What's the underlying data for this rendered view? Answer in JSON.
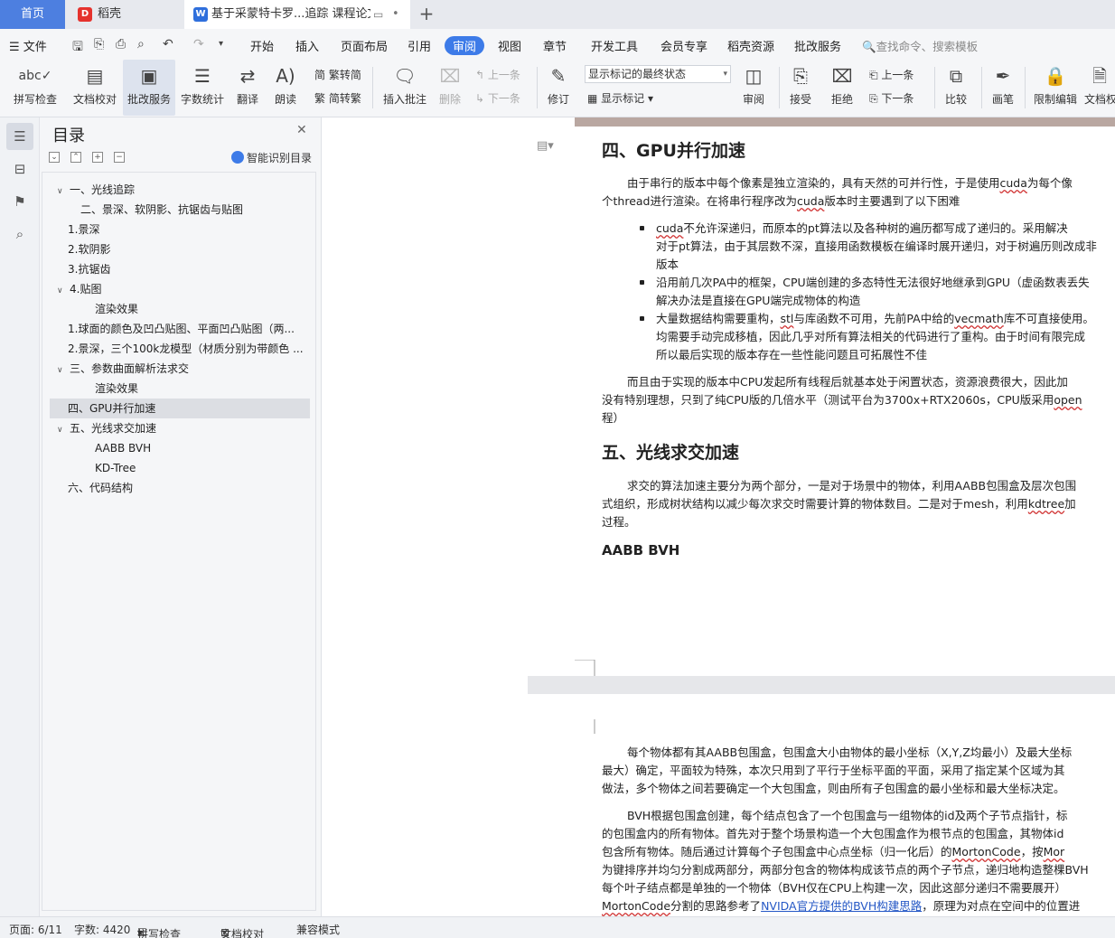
{
  "tabs": {
    "home": "首页",
    "daoke": "稻壳",
    "doc": "基于采蒙特卡罗...追踪 课程论文",
    "add_icon": "plus-icon"
  },
  "menu": {
    "file": "文件",
    "items": [
      "开始",
      "插入",
      "页面布局",
      "引用",
      "审阅",
      "视图",
      "章节",
      "开发工具",
      "会员专享",
      "稻壳资源",
      "批改服务"
    ],
    "active": "审阅",
    "search": "查找命令、搜索模板"
  },
  "ribbon": {
    "spell": "拼写检查",
    "proof": "文档校对",
    "correct_service": "批改服务",
    "wordcount": "字数统计",
    "translate": "翻译",
    "read": "朗读",
    "trad": "繁转简",
    "simp": "简转繁",
    "insert_comment": "插入批注",
    "delete": "删除",
    "prev": "上一条",
    "next": "下一条",
    "revise": "修订",
    "mark_select": "显示标记的最终状态",
    "show_marks": "显示标记",
    "review": "审阅",
    "accept": "接受",
    "reject": "拒绝",
    "prev2": "上一条",
    "next2": "下一条",
    "compare": "比较",
    "pen": "画笔",
    "restrict": "限制编辑",
    "docright": "文档权"
  },
  "outline": {
    "title": "目录",
    "smart": "智能识别目录",
    "items": [
      {
        "text": "一、光线追踪",
        "caret": "v"
      },
      {
        "text": "二、景深、软阴影、抗锯齿与贴图",
        "caret": ""
      },
      {
        "text": "1.景深",
        "caret": ""
      },
      {
        "text": "2.软阴影",
        "caret": ""
      },
      {
        "text": "3.抗锯齿",
        "caret": ""
      },
      {
        "text": "4.贴图",
        "caret": "v"
      },
      {
        "text": "渲染效果",
        "caret": ""
      },
      {
        "text": "1.球面的颜色及凹凸贴图、平面凹凸贴图（两...",
        "caret": ""
      },
      {
        "text": "2.景深，三个100k龙模型（材质分别为带颜色 ...",
        "caret": ""
      },
      {
        "text": "三、参数曲面解析法求交",
        "caret": "v"
      },
      {
        "text": "渲染效果",
        "caret": ""
      },
      {
        "text": "四、GPU并行加速",
        "caret": ""
      },
      {
        "text": "五、光线求交加速",
        "caret": "v"
      },
      {
        "text": "AABB BVH",
        "caret": ""
      },
      {
        "text": "KD-Tree",
        "caret": ""
      },
      {
        "text": "六、代码结构",
        "caret": ""
      }
    ],
    "selected_index": 11
  },
  "doc": {
    "h_gpu": "四、GPU并行加速",
    "p1_l1_a": "由于串行的版本中每个像素是独立渲染的，具有天然的可并行性，于是使用",
    "p1_l1_b": "cuda",
    "p1_l1_c": "为每个像",
    "p1_l2_a": "个thread进行渲染。在将串行程序改为",
    "p1_l2_b": "cuda",
    "p1_l2_c": "版本时主要遇到了以下困难",
    "b1_l1_a": "cuda",
    "b1_l1_b": "不允许深递归，而原本的pt算法以及各种树的遍历都写成了递归的。采用解决",
    "b1_l2": "对于pt算法，由于其层数不深，直接用函数模板在编译时展开递归，对于树遍历则改成非",
    "b1_l3": "版本",
    "b2_l1": "沿用前几次PA中的框架，CPU端创建的多态特性无法很好地继承到GPU（虚函数表丢失",
    "b2_l2": "解决办法是直接在GPU端完成物体的构造",
    "b3_l1_a": "大量数据结构需要重构，",
    "b3_l1_b": "stl",
    "b3_l1_c": "与库函数不可用，先前PA中给的",
    "b3_l1_d": "vecmath",
    "b3_l1_e": "库不可直接使用。",
    "b3_l2": "均需要手动完成移植，因此几乎对所有算法相关的代码进行了重构。由于时间有限完成",
    "b3_l3": "所以最后实现的版本存在一些性能问题且可拓展性不佳",
    "p2_l1": "而且由于实现的版本中CPU发起所有线程后就基本处于闲置状态，资源浪费很大，因此加",
    "p2_l2_a": "没有特别理想，只到了纯CPU版的几倍水平（测试平台为3700x+RTX2060s，CPU版采用",
    "p2_l2_b": "open",
    "p2_l3": "程）",
    "h_accel": "五、光线求交加速",
    "p3_l1": "求交的算法加速主要分为两个部分，一是对于场景中的物体，利用AABB包围盒及层次包围",
    "p3_l2_a": "式组织，形成树状结构以减少每次求交时需要计算的物体数目。二是对于mesh，利用",
    "p3_l2_b": "kdtree",
    "p3_l2_c": "加",
    "p3_l3": "过程。",
    "h_aabb": "AABB BVH",
    "p4_l1": "每个物体都有其AABB包围盒，包围盒大小由物体的最小坐标（X,Y,Z均最小）及最大坐标",
    "p4_l2": "最大）确定，平面较为特殊，本次只用到了平行于坐标平面的平面，采用了指定某个区域为其",
    "p4_l3": "做法，多个物体之间若要确定一个大包围盒，则由所有子包围盒的最小坐标和最大坐标决定。",
    "p5_l1": "BVH根据包围盒创建，每个结点包含了一个包围盒与一组物体的id及两个子节点指针，标",
    "p5_l2": "的包围盒内的所有物体。首先对于整个场景构造一个大包围盒作为根节点的包围盒，其物体id",
    "p5_l3_a": "包含所有物体。随后通过计算每个子包围盒中心点坐标（归一化后）的",
    "p5_l3_b": "MortonCode",
    "p5_l3_c": "，按",
    "p5_l3_d": "Mor",
    "p5_l4": "为键排序并均匀分割成两部分，两部分包含的物体构成该节点的两个子节点，递归地构造整棵BVH",
    "p5_l5": "每个叶子结点都是单独的一个物体（BVH仅在CPU上构建一次，因此这部分递归不需要展开）",
    "p5_l6_a": "MortonCode",
    "p5_l6_b": "分割的思路参考了",
    "p5_l6_c": "NVIDA官方提供的BVH构建思路",
    "p5_l6_d": "，原理为对点在空间中的位置进"
  },
  "status": {
    "page": "页面: 6/11",
    "words": "字数: 4420",
    "spell": "拼写检查",
    "proof": "文档校对",
    "compat": "兼容模式"
  },
  "colors": {
    "accent": "#3d7be8",
    "home_tab": "#4d7fe0",
    "squiggle": "#d03030",
    "link": "#2457c5"
  }
}
